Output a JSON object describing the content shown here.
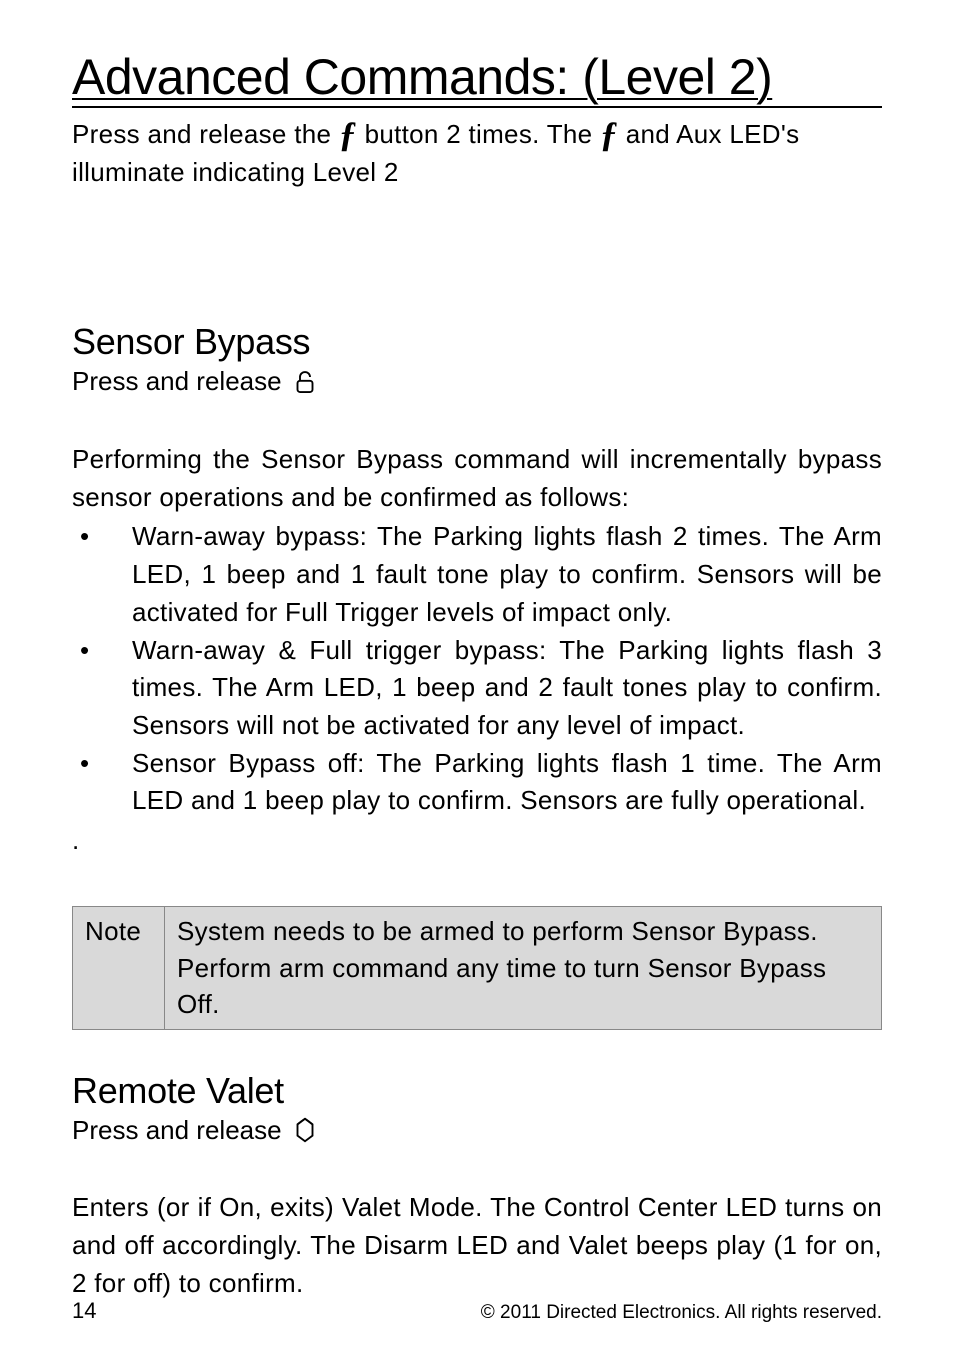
{
  "title": "Advanced Commands: (Level 2)",
  "intro": {
    "press": "Press",
    "part1": " and release the ",
    "part2": " button 2 times. The ",
    "part3": " and Aux LED's illuminate indicating Level 2"
  },
  "sensor_bypass": {
    "heading": "Sensor Bypass",
    "press": "Press",
    "and_release": " and release ",
    "body": "Performing the Sensor Bypass command will incrementally bypass sensor operations and be confirmed as follows:",
    "bullets": [
      {
        "bold": "Warn-away bypass:",
        "text": " The Parking lights flash 2 times. The Arm LED, 1 beep and 1 fault tone play to confirm. Sensors will be activated for Full Trigger levels of impact only."
      },
      {
        "bold": "Warn-away & Full trigger bypass:",
        "text": " The Parking lights flash 3 times. The Arm LED, 1 beep and 2 fault tones play to confirm. Sensors will not be activated for any level of impact."
      },
      {
        "bold": "Sensor Bypass off:",
        "text": " The Parking lights flash 1 time. The Arm LED and 1 beep play to confirm. Sensors are fully operational."
      }
    ],
    "dot": "."
  },
  "note": {
    "label": "Note",
    "content": "System needs to be armed to perform Sensor Bypass. Perform arm command any time to turn Sensor Bypass Off."
  },
  "remote_valet": {
    "heading": "Remote Valet",
    "press": "Press",
    "and_release": " and release ",
    "body": "Enters (or if On, exits) Valet Mode. The Control Center LED turns on and off accordingly. The Disarm LED and Valet beeps play (1 for on, 2 for off) to confirm."
  },
  "footer": {
    "page": "14",
    "copyright": "© 2011 Directed Electronics. All rights reserved."
  },
  "icons": {
    "f": "f",
    "lock": "lock",
    "aux": "aux"
  }
}
